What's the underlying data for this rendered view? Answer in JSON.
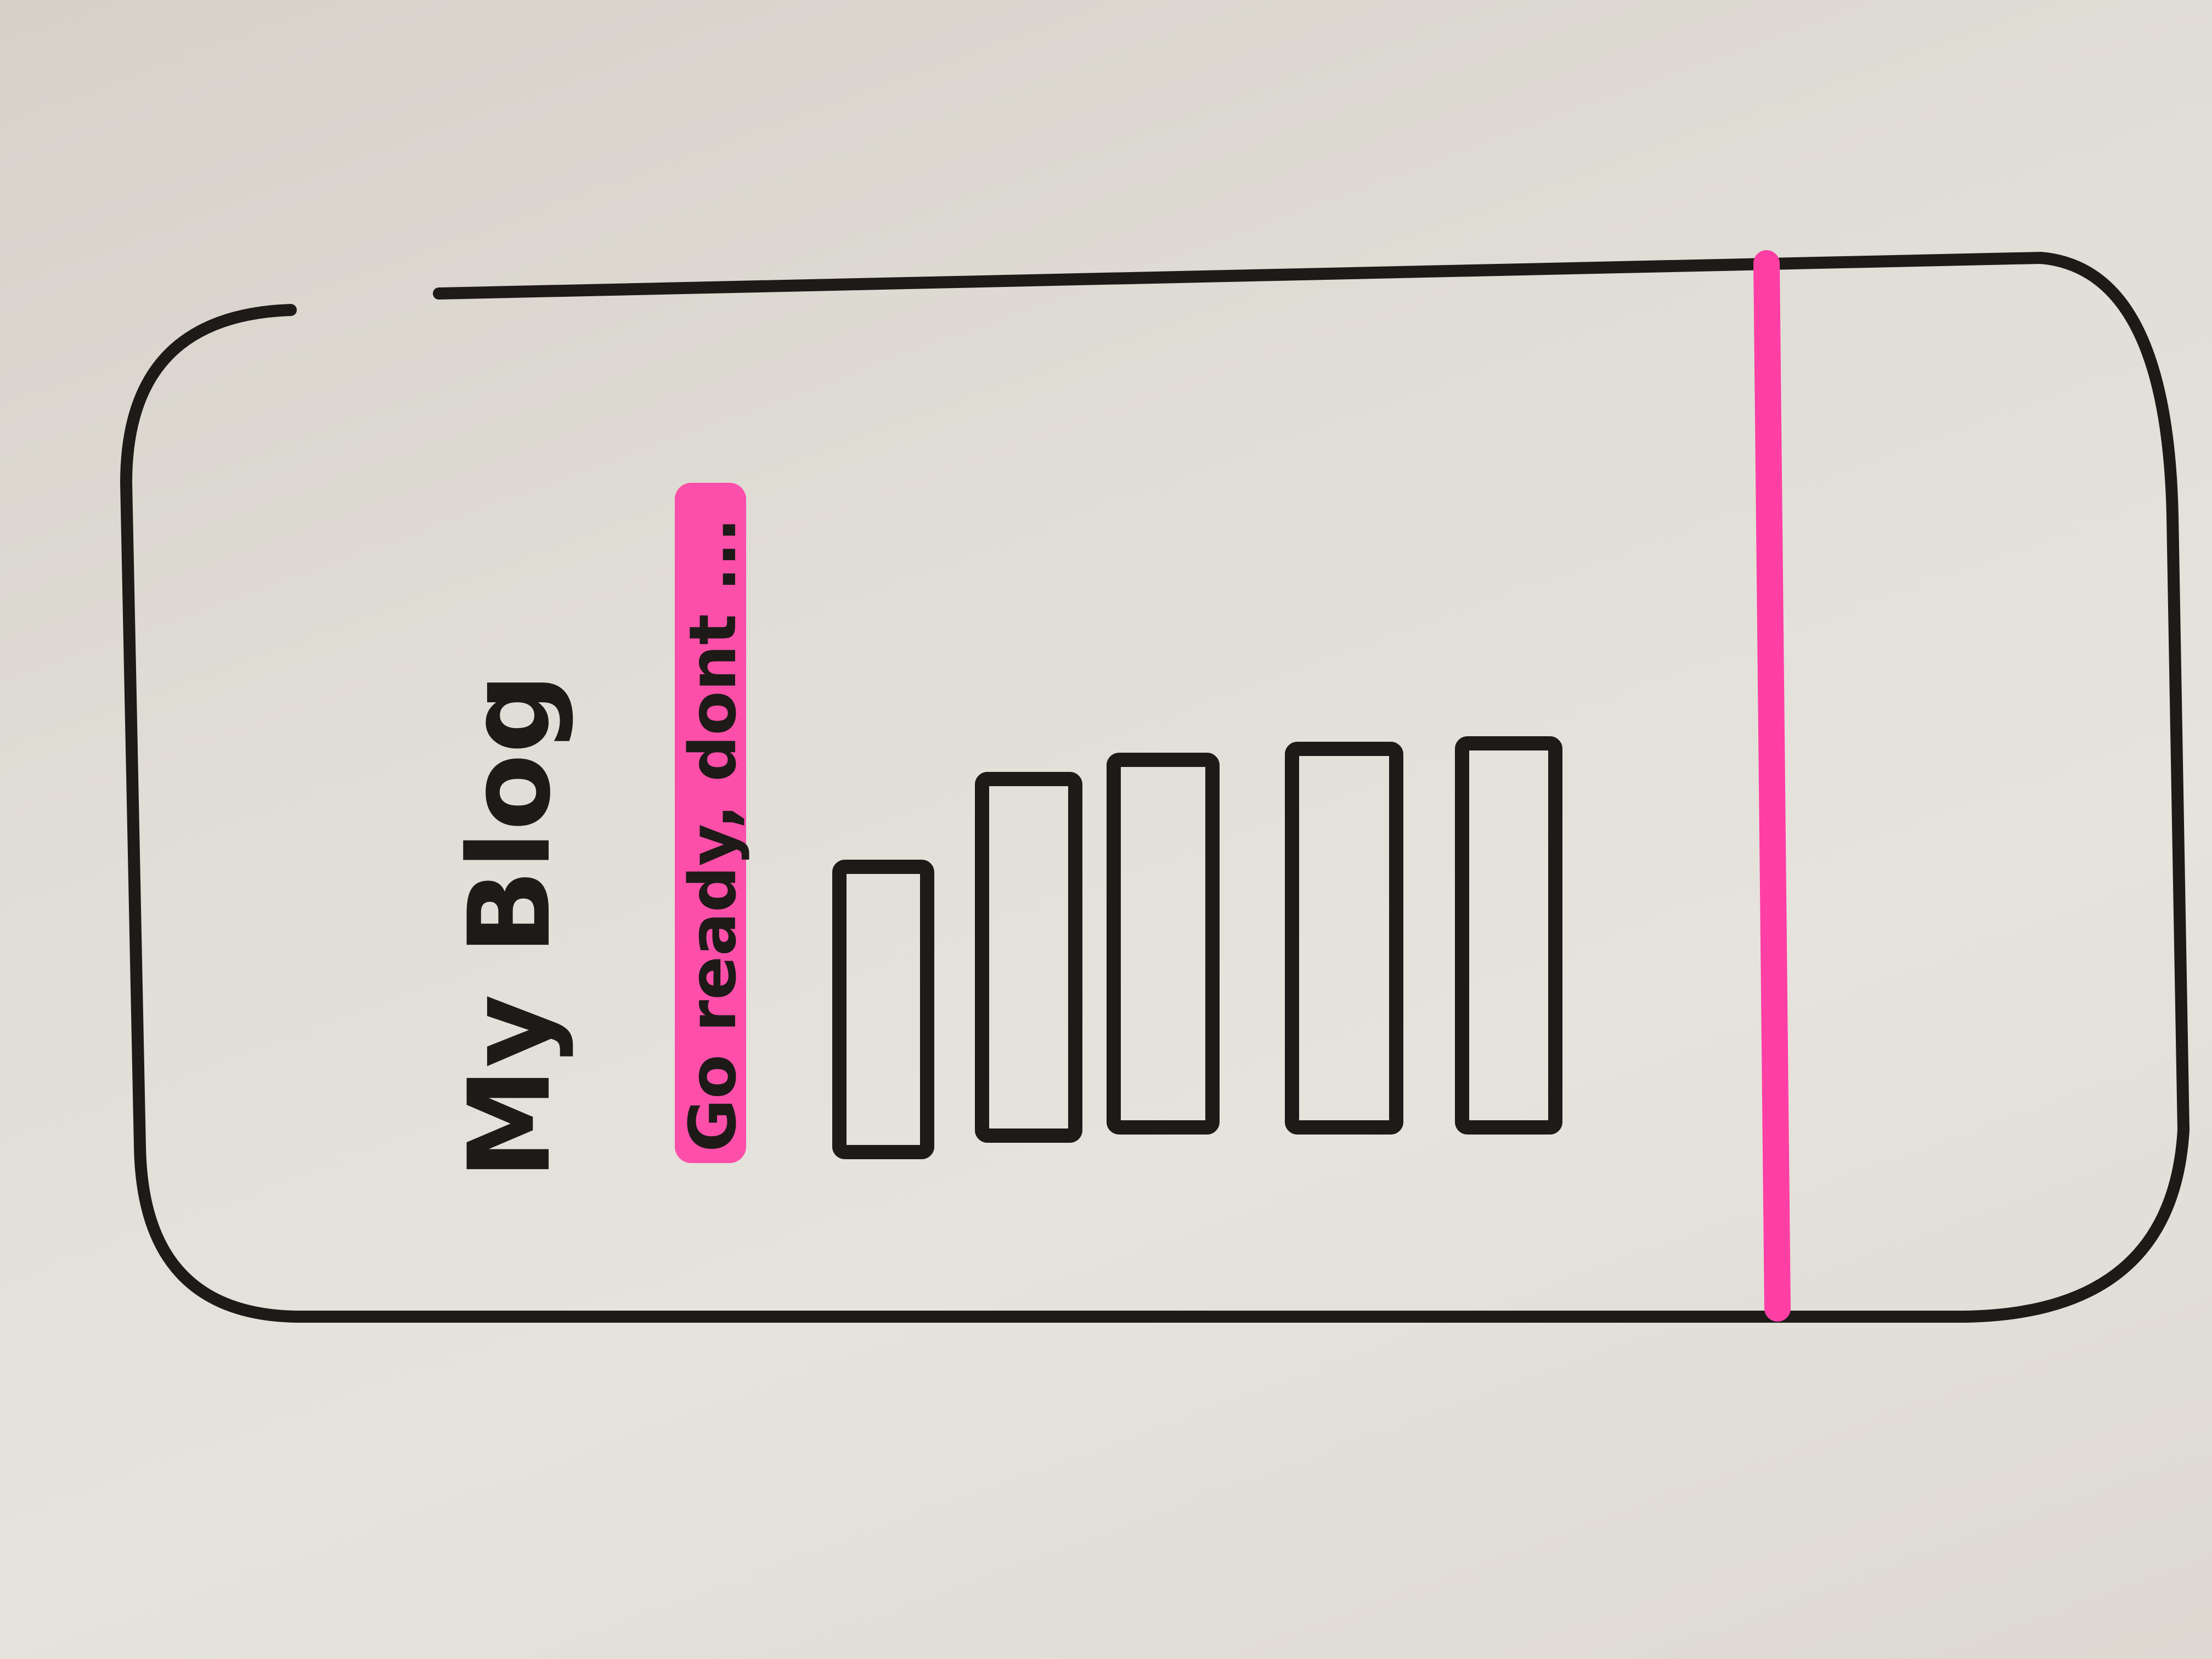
{
  "wireframe": {
    "device": "phone",
    "orientation": "rotated-90-ccw",
    "title": "My Blog",
    "subtitle": "Go ready, dont ...",
    "subtitle_highlight_color": "#ff3fa4",
    "bottom_bar_color": "#ff3fa4",
    "ink_color": "#1e1a18",
    "button_count": 5
  }
}
